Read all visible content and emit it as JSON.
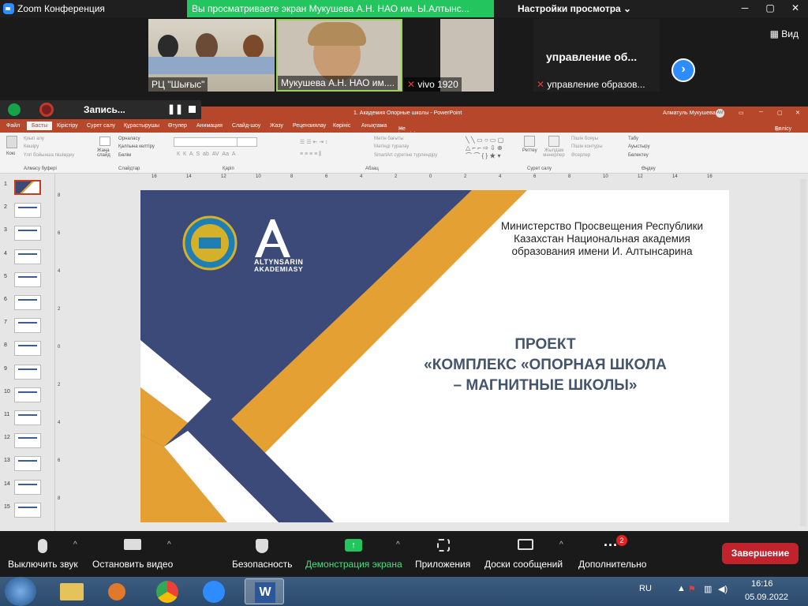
{
  "zoom": {
    "app_title": "Zoom Конференция",
    "share_banner": "Вы просматриваете экран Мукушева А.Н. НАО им. Ы.Алтынс...",
    "view_settings": "Настройки просмотра",
    "view_label": "Вид",
    "participants": [
      {
        "name": "РЦ \"Шығыс\"",
        "muted": false
      },
      {
        "name": "Мукушева А.Н. НАО им....",
        "muted": true
      },
      {
        "name": "vivo 1920",
        "muted": true
      },
      {
        "name": "управление образов...",
        "muted": true
      }
    ],
    "overflow_tile_text": "управление об...",
    "record_label": "Запись...",
    "toolbar": {
      "mute": "Выключить звук",
      "video": "Остановить видео",
      "security": "Безопасность",
      "share": "Демонстрация экрана",
      "apps": "Приложения",
      "whiteboard": "Доски сообщений",
      "more": "Дополнительно",
      "more_badge": "2",
      "end": "Завершение"
    }
  },
  "ppt": {
    "title": "1. Академия Опорные школы - PowerPoint",
    "user": "Алматуль Мукушева",
    "user_initials": "АМ",
    "tabs": [
      "Файл",
      "Басты",
      "Кірістіру",
      "Сурет салу",
      "Құрастырушы",
      "Өтулер",
      "Анимация",
      "Слайд-шоу",
      "Жазу",
      "Рецензиялау",
      "Көрініс",
      "Анықтама"
    ],
    "tellme": "Не істегіңіз келетінін маған айтыңыз",
    "share": "Бөлісу",
    "groups": [
      "Алмасу буферi",
      "Слайдтар",
      "Қаріп",
      "Абзац",
      "Сурет салу",
      "Өңдеу"
    ],
    "ribbon": {
      "paste": "Кою",
      "cut": "Қиып алу",
      "copy": "Көшіру",
      "format": "Үлгі бойынша пішімдеу",
      "new_slide": "Жаңа слайд",
      "layout": "Орналасу",
      "reset": "Қалпына келтіру",
      "section": "Бөлім",
      "text_direction": "Мәтін бағыты",
      "align_text": "Мәтінді туралау",
      "smartart": "SmartArt суретіне түрлендіру",
      "arrange": "Реттеу",
      "quick_styles": "Жылдам мәнерлер",
      "shape_fill": "Пішін бояуы",
      "shape_outline": "Пішін контуры",
      "effects": "Әсерлер",
      "find": "Табу",
      "replace": "Ауыстыру",
      "select": "Бөлектеу"
    },
    "slide_count": 15,
    "slide": {
      "ministry": "Министерство Просвещения Республики Казахстан Национальная академия образования имени И. Алтынсарина",
      "project_line1": "ПРОЕКТ",
      "project_line2": "«КОМПЛЕКС «ОПОРНАЯ ШКОЛА",
      "project_line3": "– МАГНИТНЫЕ ШКОЛЫ»",
      "logo_text_1": "ALTYNSARIN",
      "logo_text_2": "AKADEMIASY",
      "logo_year": "1921"
    }
  },
  "taskbar": {
    "lang": "RU",
    "time": "16:16",
    "date": "05.09.2022"
  }
}
